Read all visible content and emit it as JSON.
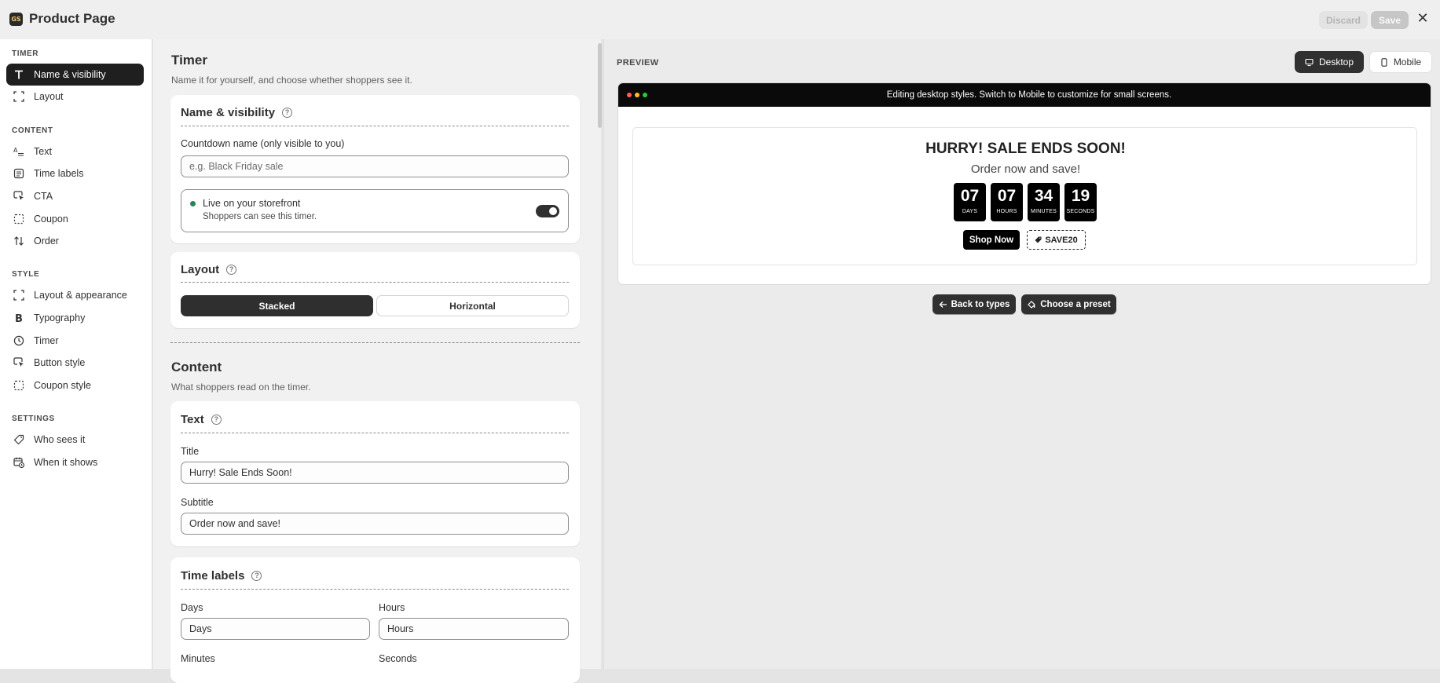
{
  "app": {
    "logo_text": "GS",
    "title": "Product Page"
  },
  "header": {
    "discard_label": "Discard",
    "save_label": "Save",
    "close_icon": "close-icon"
  },
  "sidebar": {
    "sections": [
      {
        "label": "TIMER",
        "items": [
          {
            "label": "Name & visibility",
            "icon": "text-icon",
            "active": true
          },
          {
            "label": "Layout",
            "icon": "frame-icon"
          }
        ]
      },
      {
        "label": "CONTENT",
        "items": [
          {
            "label": "Text",
            "icon": "text-style-icon"
          },
          {
            "label": "Time labels",
            "icon": "list-icon"
          },
          {
            "label": "CTA",
            "icon": "cursor-icon"
          },
          {
            "label": "Coupon",
            "icon": "dashed-square-icon"
          },
          {
            "label": "Order",
            "icon": "sort-icon"
          }
        ]
      },
      {
        "label": "STYLE",
        "items": [
          {
            "label": "Layout & appearance",
            "icon": "frame-icon"
          },
          {
            "label": "Typography",
            "icon": "bold-icon"
          },
          {
            "label": "Timer",
            "icon": "clock-icon"
          },
          {
            "label": "Button style",
            "icon": "cursor-icon"
          },
          {
            "label": "Coupon style",
            "icon": "dashed-square-icon"
          }
        ]
      },
      {
        "label": "SETTINGS",
        "items": [
          {
            "label": "Who sees it",
            "icon": "tag-icon"
          },
          {
            "label": "When it shows",
            "icon": "calendar-clock-icon"
          }
        ]
      }
    ]
  },
  "editor": {
    "timer_section": {
      "title": "Timer",
      "description": "Name it for yourself, and choose whether shoppers see it."
    },
    "name_card": {
      "title": "Name & visibility",
      "countdown_label": "Countdown name (only visible to you)",
      "countdown_placeholder": "e.g. Black Friday sale",
      "live_title": "Live on your storefront",
      "live_subtitle": "Shoppers can see this timer.",
      "live_enabled": true
    },
    "layout_card": {
      "title": "Layout",
      "options": [
        "Stacked",
        "Horizontal"
      ],
      "selected": "Stacked"
    },
    "content_section": {
      "title": "Content",
      "description": "What shoppers read on the timer."
    },
    "text_card": {
      "title": "Text",
      "title_label": "Title",
      "title_value": "Hurry! Sale Ends Soon!",
      "subtitle_label": "Subtitle",
      "subtitle_value": "Order now and save!"
    },
    "time_labels_card": {
      "title": "Time labels",
      "days_label": "Days",
      "days_value": "Days",
      "hours_label": "Hours",
      "hours_value": "Hours",
      "minutes_label": "Minutes",
      "seconds_label": "Seconds"
    }
  },
  "preview": {
    "label": "PREVIEW",
    "desktop_label": "Desktop",
    "mobile_label": "Mobile",
    "selected_device": "Desktop",
    "browser_message": "Editing desktop styles. Switch to Mobile to customize for small screens.",
    "timer": {
      "title": "HURRY! SALE ENDS SOON!",
      "subtitle": "Order now and save!",
      "units": [
        {
          "value": "07",
          "label": "DAYS"
        },
        {
          "value": "07",
          "label": "HOURS"
        },
        {
          "value": "34",
          "label": "MINUTES"
        },
        {
          "value": "19",
          "label": "SECONDS"
        }
      ],
      "cta_label": "Shop Now",
      "coupon_code": "SAVE20"
    },
    "back_label": "Back to types",
    "preset_label": "Choose a preset"
  },
  "colors": {
    "accent_dark": "#303030",
    "live_green": "#29845a",
    "dot_red": "#ff5f57",
    "dot_yellow": "#febc2e",
    "dot_green": "#28c840"
  }
}
